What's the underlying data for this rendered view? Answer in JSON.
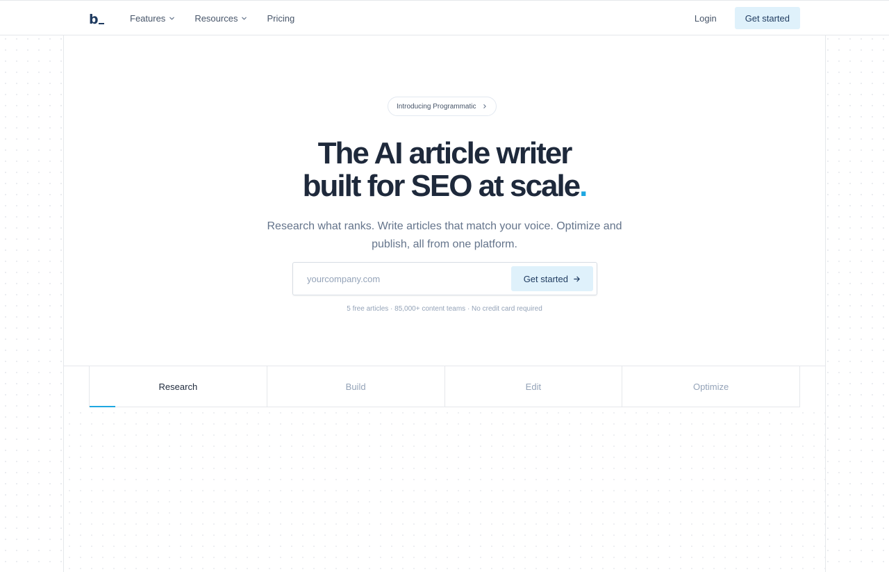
{
  "nav": {
    "logo_text": "b",
    "links": [
      {
        "label": "Features",
        "has_dropdown": true
      },
      {
        "label": "Resources",
        "has_dropdown": true
      },
      {
        "label": "Pricing",
        "has_dropdown": false
      }
    ],
    "login_label": "Login",
    "cta_label": "Get started"
  },
  "hero": {
    "badge_label": "Introducing Programmatic",
    "headline_line1": "The AI article writer",
    "headline_line2": "built for SEO at scale",
    "headline_dot": ".",
    "subhead": "Research what ranks. Write articles that match your voice. Optimize and publish, all from one platform.",
    "input_placeholder": "yourcompany.com",
    "input_value": "",
    "cta_label": "Get started",
    "fineprint": "5 free articles · 85,000+ content teams · No credit card required"
  },
  "tabs": {
    "items": [
      {
        "label": "Research",
        "active": true
      },
      {
        "label": "Build",
        "active": false
      },
      {
        "label": "Edit",
        "active": false
      },
      {
        "label": "Optimize",
        "active": false
      }
    ],
    "active_progress": 0.145
  },
  "colors": {
    "accent": "#1ea7e1",
    "button_bg": "#dff1fb",
    "heading": "#1e293b",
    "muted": "#64748b"
  }
}
